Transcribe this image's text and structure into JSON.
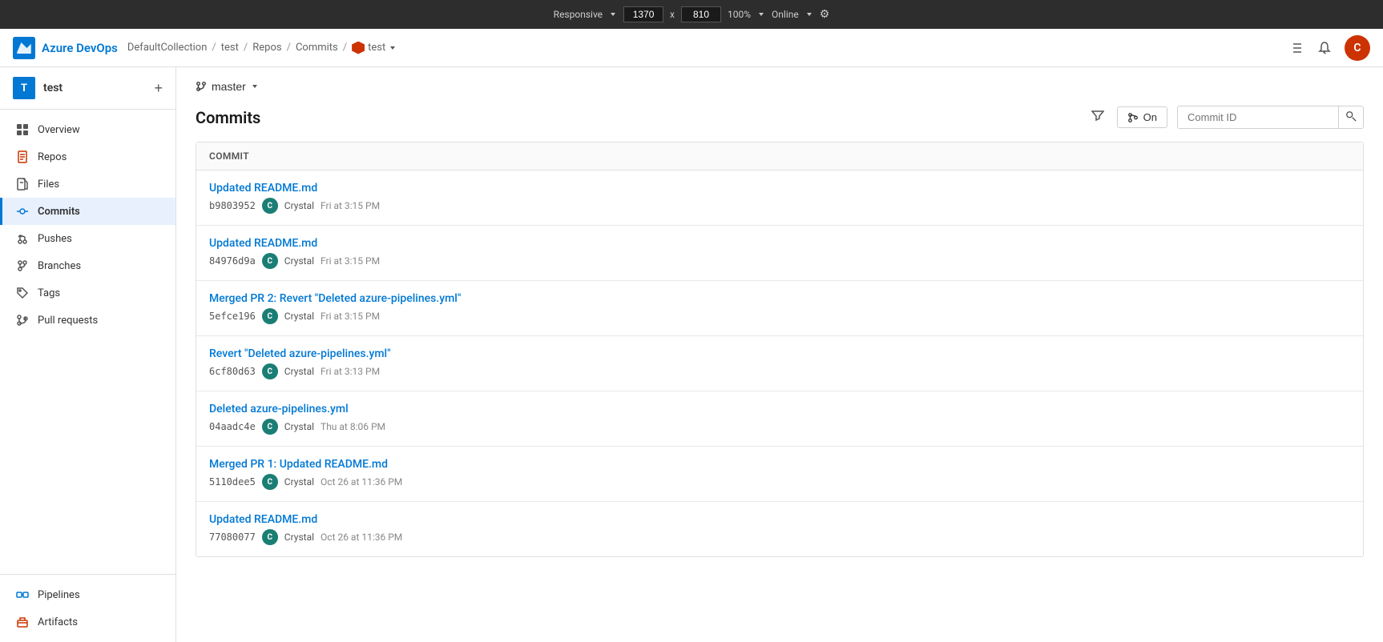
{
  "browser": {
    "responsive_label": "Responsive",
    "width": "1370",
    "x_label": "x",
    "height": "810",
    "zoom": "100%",
    "online": "Online"
  },
  "header": {
    "logo_text": "Azure DevOps",
    "breadcrumb": {
      "collection": "DefaultCollection",
      "sep1": "/",
      "project": "test",
      "sep2": "/",
      "repos": "Repos",
      "sep3": "/",
      "commits": "Commits",
      "sep4": "/",
      "repo": "test"
    },
    "user_initial": "C"
  },
  "sidebar": {
    "project_name": "test",
    "project_initial": "T",
    "add_btn": "+",
    "nav_items": [
      {
        "id": "overview",
        "label": "Overview",
        "icon": "overview-icon"
      },
      {
        "id": "repos",
        "label": "Repos",
        "icon": "repos-icon"
      },
      {
        "id": "files",
        "label": "Files",
        "icon": "files-icon"
      },
      {
        "id": "commits",
        "label": "Commits",
        "icon": "commits-icon",
        "active": true
      },
      {
        "id": "pushes",
        "label": "Pushes",
        "icon": "pushes-icon"
      },
      {
        "id": "branches",
        "label": "Branches",
        "icon": "branches-icon"
      },
      {
        "id": "tags",
        "label": "Tags",
        "icon": "tags-icon"
      },
      {
        "id": "pull-requests",
        "label": "Pull requests",
        "icon": "pr-icon"
      },
      {
        "id": "pipelines",
        "label": "Pipelines",
        "icon": "pipelines-icon"
      },
      {
        "id": "artifacts",
        "label": "Artifacts",
        "icon": "artifacts-icon"
      }
    ]
  },
  "content": {
    "branch": {
      "name": "master",
      "icon": "branch-icon"
    },
    "title": "Commits",
    "filter_btn_label": "Filter",
    "toggle_btn": {
      "label": "On",
      "icon": "toggle-icon"
    },
    "commit_id_placeholder": "Commit ID",
    "table": {
      "header": "Commit",
      "rows": [
        {
          "message": "Updated README.md",
          "hash": "b9803952",
          "author": "Crystal",
          "date": "Fri at 3:15 PM",
          "avatar_initial": "C"
        },
        {
          "message": "Updated README.md",
          "hash": "84976d9a",
          "author": "Crystal",
          "date": "Fri at 3:15 PM",
          "avatar_initial": "C"
        },
        {
          "message": "Merged PR 2: Revert \"Deleted azure-pipelines.yml\"",
          "hash": "5efce196",
          "author": "Crystal",
          "date": "Fri at 3:15 PM",
          "avatar_initial": "C"
        },
        {
          "message": "Revert \"Deleted azure-pipelines.yml\"",
          "hash": "6cf80d63",
          "author": "Crystal",
          "date": "Fri at 3:13 PM",
          "avatar_initial": "C"
        },
        {
          "message": "Deleted azure-pipelines.yml",
          "hash": "04aadc4e",
          "author": "Crystal",
          "date": "Thu at 8:06 PM",
          "avatar_initial": "C"
        },
        {
          "message": "Merged PR 1: Updated README.md",
          "hash": "5110dee5",
          "author": "Crystal",
          "date": "Oct 26 at 11:36 PM",
          "avatar_initial": "C"
        },
        {
          "message": "Updated README.md",
          "hash": "77080077",
          "author": "Crystal",
          "date": "Oct 26 at 11:36 PM",
          "avatar_initial": "C"
        }
      ]
    }
  }
}
